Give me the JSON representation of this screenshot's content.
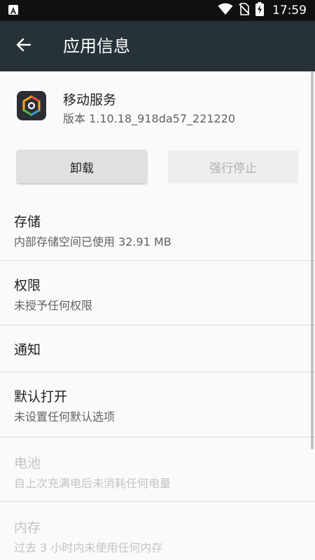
{
  "status_bar": {
    "time": "17:59",
    "icons": [
      "app-notification-icon",
      "wifi-icon",
      "no-sim-icon",
      "battery-charging-icon"
    ]
  },
  "app_bar": {
    "title": "应用信息",
    "back_icon": "arrow-back-icon"
  },
  "app": {
    "name": "移动服务",
    "version": "版本 1.10.18_918da57_221220",
    "icon": "app-logo-icon"
  },
  "buttons": {
    "uninstall": "卸载",
    "force_stop": "强行停止"
  },
  "items": [
    {
      "title": "存储",
      "subtitle": "内部存储空间已使用 32.91 MB",
      "enabled": true
    },
    {
      "title": "权限",
      "subtitle": "未授予任何权限",
      "enabled": true
    },
    {
      "title": "通知",
      "subtitle": "",
      "enabled": true
    },
    {
      "title": "默认打开",
      "subtitle": "未设置任何默认选项",
      "enabled": true
    },
    {
      "title": "电池",
      "subtitle": "自上次充满电后未消耗任何电量",
      "enabled": false
    },
    {
      "title": "内存",
      "subtitle": "过去 3 小时内未使用任何内存",
      "enabled": false
    }
  ],
  "colors": {
    "app_bar": "#263238",
    "status_bar": "#101010",
    "background": "#fafafa",
    "divider": "#dedede"
  }
}
